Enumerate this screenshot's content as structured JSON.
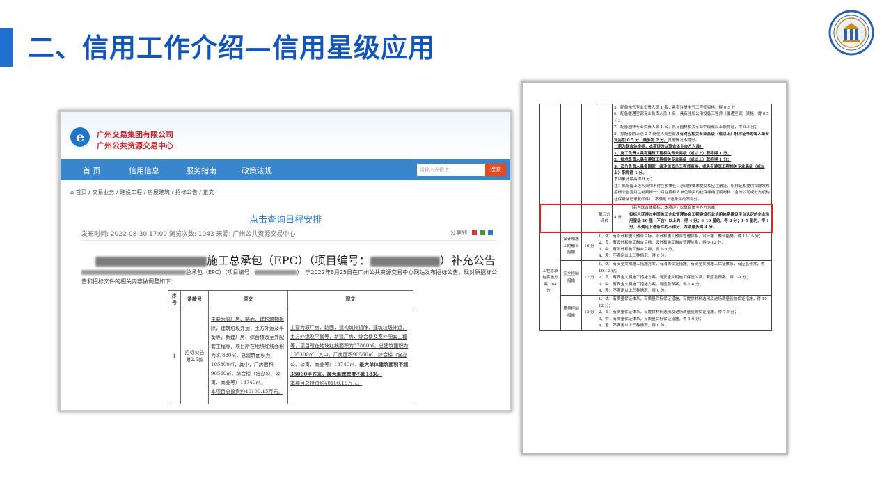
{
  "slide": {
    "title": "二、信用工作介绍—信用星级应用",
    "accent": "#1f6fd1"
  },
  "site": {
    "name_line1": "广州交易集团有限公司",
    "name_line2": "广州公共资源交易中心",
    "nav": [
      "首 页",
      "信用信息",
      "服务指南",
      "政策法规"
    ],
    "search_placeholder": "请输入关键字",
    "search_button": "搜索",
    "breadcrumb": "首页 / 交易业务 / 建设工程 / 房屋建筑 / 招标公告 / 正文",
    "schedule_link": "点击查询日程安排",
    "meta": "发布时间: 2022-08-30 17:00   浏览次数: 1043      来源: 广州公共资源交易中心",
    "share_label": "分享到:",
    "notice_title_main": "施工总承包（EPC）（项目编号：",
    "notice_title_tail": "）补充公告",
    "intro_part1": "总承包（EPC）（项目编号：",
    "intro_part2": "），于2022年8月25日在广州公共资源交易中心网站发布招标公告，现对原招标公告和招标文件的相关内容做调整如下：",
    "table": {
      "headers": [
        "序号",
        "条款号",
        "原文",
        "现文"
      ],
      "row_no": "1",
      "clause": "招标公告第2.5款",
      "original": "主要为原厂房、路面、建构筑物拆除，建筑垃圾外运，土方外运及平衡等，新建厂房、综合楼及室外配套工程等，项目所在地块红线面积为37880㎡，总建筑面积为105300㎡，其中，厂房面积90560㎡，综合楼（含办公、公寓、商业等）14740㎡。",
      "original_invest": "本项目总投资约40100.15万元。",
      "current": "主要为原厂房、路面、建构筑物拆除，建筑垃圾外运，土方外运及平衡等，新建厂房、综合楼及室外配套工程等，项目所在地块红线面积为37880㎡，总建筑面积为105300㎡，其中，厂房面积90560㎡，综合楼（含办公、公寓、商业等）14740㎡，",
      "current_bold": "最大单体建筑面积不超35000平方米，最大单跨跨度不超18米。",
      "current_invest": "本项目总投资约40100.15万元。"
    }
  },
  "score_doc": {
    "top_lines": [
      "5、配备电气专业负责人员 1 名；具有注册电气工程师资格，得 0.5 分；",
      "6、配备暖通空调专业负责人员 1 名，具有注册公用设备工程师（暖通空调）资格，得 0.5 分；",
      "7、配备园林专业负责人员 1 名，具有园林相关专业中级或以上职称证，得 0.5 分；",
      "8、拟配备的上述 2-7 岗位人员全部",
      "具有对应相关专业高级（或以上）职称证书的每人每专业另加 0.5 分，最多加 2 分。",
      "其他情况不得分。",
      "（若为联合体投标，本项评分以联合体主办方为准）",
      "1、施工负责人具有建筑工程相关专业高级（或以上）职称得 1 分；",
      "2、技术负责人具有建筑工程相关专业高级（或以上）职称得 1 分；",
      "3、造价负责人具备国家一级注册造价工程师资格，或具有建筑工程相关专业高级（或以上）职称得 1 分。",
      "本项累计最高得 9 分；",
      "注：拟配备上述人员均不得互相兼任，必须按要求提交相应注册证、职称证和提供扣除发布招标公告当月往前顺推一个月在投标人单位购买的社保缴纳证明材料（含分公司或分支机构社保缴纳记录复印件），不满足上述条件的不得分。"
    ],
    "third_party": {
      "label": "第三方评价",
      "score": "4 分",
      "note": "（若为联合体投标，本项评分以联合体主办方为准）",
      "text": "投标人获得过中国施工企业管理协会工程建设行业信用体系建设平台认定的企业信用星级 10 星（不含）以上的，得 4 分；6-10 星的，得 2 分；1-5 星的，得 1 分，不满足上述条件的不得分，本项最多得 4 分。"
    },
    "section_label": "工程总承包实施方案（64 分）",
    "rows": [
      {
        "label": "设计和施工的融合措施",
        "score": "16 分",
        "lines": [
          "1、优：有设计和施工融合目标，设计和施工融合管理体系，设计施工融合措施，得 13-16 分；",
          "2、良：有设计和施工融合目标、设计和施工融合管理体系，得 9-12 分；",
          "3、中：有设计和施工融合目标，得 1-8 分；",
          "4、差：不满足以上三种情况，得 0 分。"
        ]
      },
      {
        "label": "安全控制措施",
        "score": "12 分",
        "lines": [
          "1、优：有安全文明施工措施方案，有消防保证措施，有安全文明施工保证体系，有应急预案，得 10-12 分；",
          "2、良：有安全文明施工措施方案，有安全文明施工保证体系，有应急预案，得 7-9 分；",
          "3、中：有安全文明施工措施方案，有应急预案，得 1-6 分；",
          "4、差：不满足以上三种情况，得 0 分。"
        ]
      },
      {
        "label": "质量控制措施",
        "score": "12 分",
        "lines": [
          "1、优：有质量保证体系，有质量目标保证措施，有提供材料选用及进场质量验收保证措施，得 10-12 分；",
          "2、良：有质量保证体系，有提供材料选用及进场质量验收保证措施，得 7-9 分；",
          "3、中：有质量保证体系，有质量目标保证措施，得 1-6 分；",
          "4、差：不满足以上三种情况，得 0 分。"
        ]
      }
    ]
  }
}
